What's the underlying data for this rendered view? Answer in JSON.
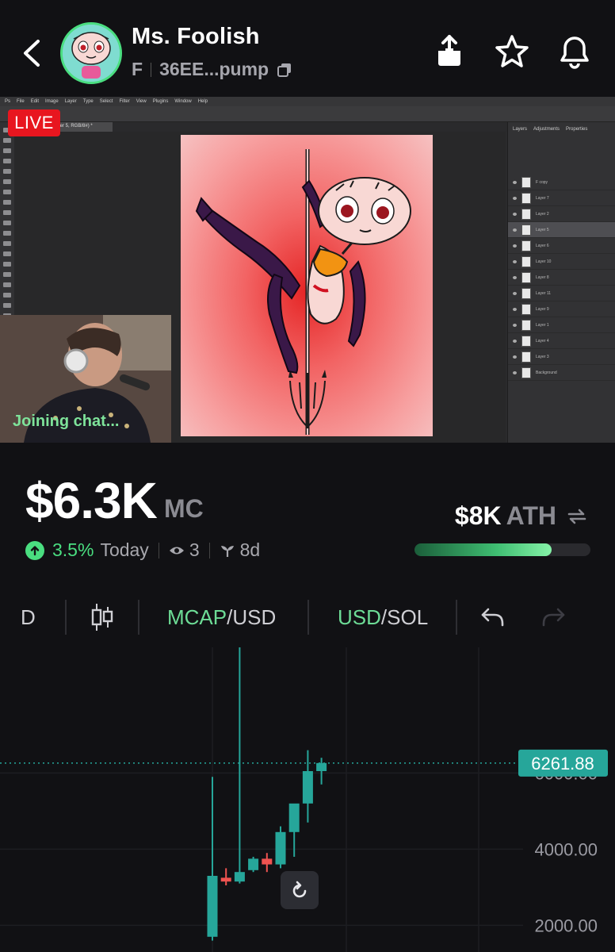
{
  "header": {
    "token_name": "Ms. Foolish",
    "symbol": "F",
    "address": "36EE...pump"
  },
  "stream": {
    "live_label": "LIVE",
    "status_text": "Joining chat...",
    "ps_menu": [
      "Ps",
      "File",
      "Edit",
      "Image",
      "Layer",
      "Type",
      "Select",
      "Filter",
      "View",
      "Plugins",
      "Window",
      "Help"
    ],
    "ps_tab": "Layer 5, RGB/8#) *",
    "ps_panel_tabs": [
      "Layers",
      "Adjustments",
      "Properties"
    ],
    "ps_layers": [
      "F copy",
      "Layer 7",
      "Layer 2",
      "Layer 5",
      "Layer 6",
      "Layer 10",
      "Layer 8",
      "Layer 11",
      "Layer 9",
      "Layer 1",
      "Layer 4",
      "Layer 3",
      "Background"
    ]
  },
  "market": {
    "market_cap": "$6.3K",
    "market_cap_label": "MC",
    "change_pct": "3.5%",
    "change_period": "Today",
    "viewers": "3",
    "age": "8d",
    "ath_value": "$8K",
    "ath_label": "ATH",
    "ath_progress": 0.78,
    "accent_green": "#4ade80",
    "live_red": "#e8161f"
  },
  "toolbar": {
    "interval": "D",
    "mcap_primary": "MCAP",
    "mcap_secondary": "/USD",
    "usd_primary": "USD",
    "usd_secondary": "/SOL"
  },
  "chart_data": {
    "type": "candlestick",
    "current_price": "6261.88",
    "price_tick_labels": [
      "6000.00",
      "4000.00",
      "2000.00"
    ],
    "ylim": [
      1300,
      9300
    ],
    "up_color": "#26a69a",
    "down_color": "#ef5350",
    "candles": [
      {
        "o": 1700,
        "h": 5900,
        "l": 1600,
        "c": 3300
      },
      {
        "o": 3250,
        "h": 3500,
        "l": 3050,
        "c": 3150
      },
      {
        "o": 3150,
        "h": 9300,
        "l": 3100,
        "c": 3400
      },
      {
        "o": 3450,
        "h": 3800,
        "l": 3400,
        "c": 3750
      },
      {
        "o": 3750,
        "h": 3900,
        "l": 3400,
        "c": 3600
      },
      {
        "o": 3600,
        "h": 4600,
        "l": 3500,
        "c": 4450
      },
      {
        "o": 4450,
        "h": 5100,
        "l": 3800,
        "c": 5200
      },
      {
        "o": 5200,
        "h": 6600,
        "l": 4700,
        "c": 6050
      },
      {
        "o": 6050,
        "h": 6400,
        "l": 5700,
        "c": 6261.88
      }
    ]
  }
}
